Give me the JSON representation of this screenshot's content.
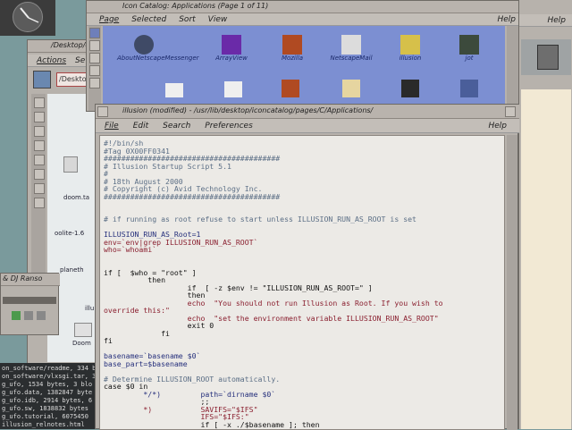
{
  "icon_catalog": {
    "title": "Icon Catalog: Applications (Page 1 of 11)",
    "menu": [
      "Page",
      "Selected",
      "Sort",
      "View"
    ],
    "help": "Help",
    "icons": [
      {
        "label": "AboutNetscapeMessenger",
        "icon": "netscape-messenger-icon"
      },
      {
        "label": "ArrayView",
        "icon": "arrayview-icon"
      },
      {
        "label": "Mozilla",
        "icon": "mozilla-icon"
      },
      {
        "label": "NetscapeMail",
        "icon": "netscape-mail-icon"
      },
      {
        "label": "illusion",
        "icon": "illusion-icon"
      },
      {
        "label": "jot",
        "icon": "jot-icon"
      }
    ]
  },
  "desktop_window": {
    "title": "/Desktop/d",
    "menu": [
      "Actions",
      "Se"
    ],
    "path_field": "/Deskto",
    "items": [
      "doom.ta",
      "oolite-1.6",
      "planeth",
      "illu",
      "Doom"
    ]
  },
  "editor": {
    "title": "illusion (modified) - /usr/lib/desktop/iconcatalog/pages/C/Applications/",
    "menu": [
      "File",
      "Edit",
      "Search",
      "Preferences"
    ],
    "help": "Help",
    "lines": [
      {
        "t": "#!/bin/sh",
        "c": "cmt"
      },
      {
        "t": "#Tag 0X00FF0341",
        "c": "cmt"
      },
      {
        "t": "########################################",
        "c": "cmt"
      },
      {
        "t": "# Illusion Startup Script 5.1",
        "c": "cmt"
      },
      {
        "t": "#",
        "c": "cmt"
      },
      {
        "t": "# 18th August 2000",
        "c": "cmt"
      },
      {
        "t": "# Copyright (c) Avid Technology Inc.",
        "c": "cmt"
      },
      {
        "t": "########################################",
        "c": "cmt"
      },
      {
        "t": "",
        "c": "kw"
      },
      {
        "t": "",
        "c": "kw"
      },
      {
        "t": "# if running as root refuse to start unless ILLUSION_RUN_AS_ROOT is set",
        "c": "cmt"
      },
      {
        "t": "",
        "c": "kw"
      },
      {
        "t": "ILLUSION_RUN_AS_Root=1",
        "c": "var"
      },
      {
        "t": "env=`env|grep ILLUSION_RUN_AS_ROOT`",
        "c": "str"
      },
      {
        "t": "who=`whoami`",
        "c": "str"
      },
      {
        "t": "",
        "c": "kw"
      },
      {
        "t": "",
        "c": "kw"
      },
      {
        "t": "if [  $who = \"root\" ]",
        "c": "kw"
      },
      {
        "t": "          then",
        "c": "kw"
      },
      {
        "t": "                   if  [ -z $env != \"ILLUSION_RUN_AS_ROOT=\" ]",
        "c": "kw"
      },
      {
        "t": "                   then",
        "c": "kw"
      },
      {
        "t": "                   echo  \"You should not run Illusion as Root. If you wish to",
        "c": "str"
      },
      {
        "t": "override this:\"",
        "c": "str"
      },
      {
        "t": "                   echo  \"set the environment variable ILLUSION_RUN_AS_ROOT\"",
        "c": "str"
      },
      {
        "t": "                   exit 0",
        "c": "kw"
      },
      {
        "t": "             fi",
        "c": "kw"
      },
      {
        "t": "fi",
        "c": "kw"
      },
      {
        "t": "",
        "c": "kw"
      },
      {
        "t": "basename=`basename $0`",
        "c": "var"
      },
      {
        "t": "base_part=$basename",
        "c": "var"
      },
      {
        "t": "",
        "c": "kw"
      },
      {
        "t": "# Determine ILLUSION_ROOT automatically.",
        "c": "cmt"
      },
      {
        "t": "case $0 in",
        "c": "kw"
      },
      {
        "t": "         */*)         path=`dirname $0`",
        "c": "var"
      },
      {
        "t": "                      ;;",
        "c": "kw"
      },
      {
        "t": "         *)           SAVIFS=\"$IFS\"",
        "c": "str"
      },
      {
        "t": "                      IFS=\"$IFS:\"",
        "c": "str"
      },
      {
        "t": "                      if [ -x ./$basename ]; then",
        "c": "kw"
      }
    ]
  },
  "player_window": {
    "title": "& DJ Ranso"
  },
  "terminal": {
    "lines": [
      "on_software/readme, 334 b",
      "on_software/vlxsgi.tar, 3",
      "g_ufo, 1534 bytes, 3 blo",
      "g_ufo.data, 1382847 byte",
      "g_ufo.idb, 2914 bytes, 6",
      "g_ufo.sw, 1838832 bytes",
      "g_ufo.tutorial, 6075450",
      "illusion_relnotes.html"
    ]
  },
  "right_panel": {
    "help": "Help"
  },
  "colors": {
    "catalog_bg": "#7c8fd2",
    "editor_bg": "#eceae6",
    "chrome": "#c3beb8",
    "desktop": "#7a9a9c"
  }
}
